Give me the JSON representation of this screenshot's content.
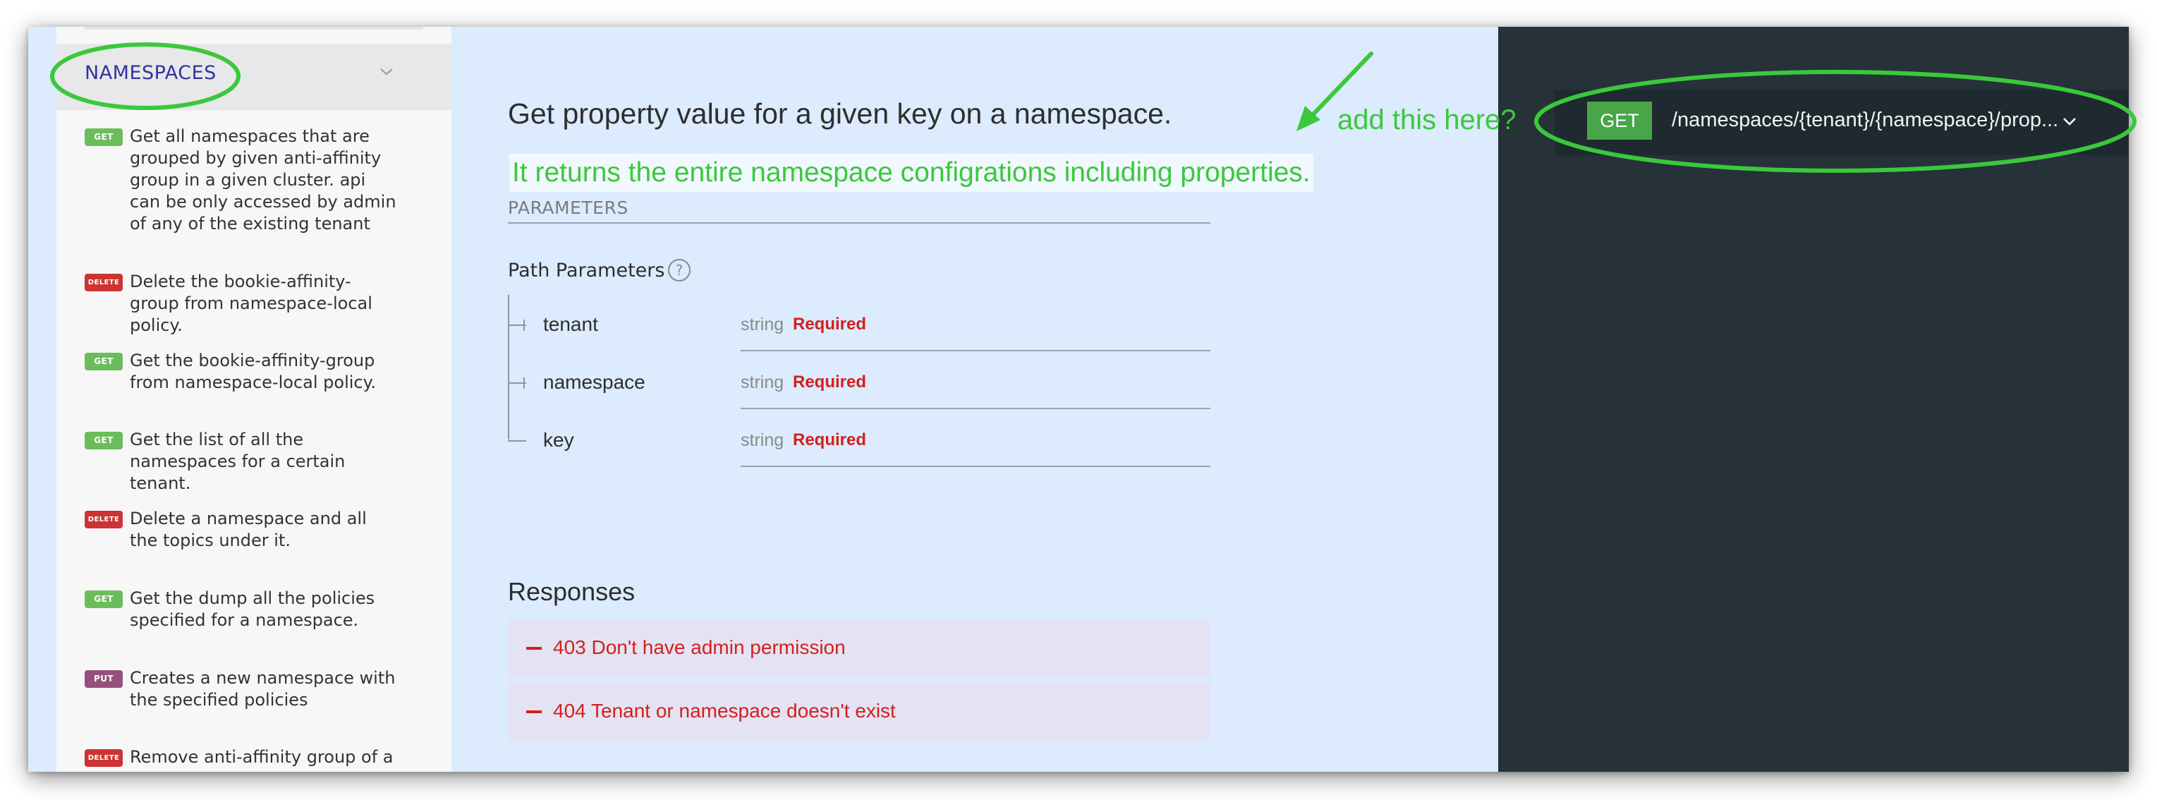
{
  "sidebar": {
    "section_label": "NAMESPACES",
    "items": [
      {
        "method": "GET",
        "text": "Get all namespaces that are grouped by given anti-affinity group in a given cluster. api can be only accessed by admin of any of the existing tenant"
      },
      {
        "method": "DELETE",
        "text": "Delete the bookie-affinity-group from namespace-local policy."
      },
      {
        "method": "GET",
        "text": "Get the bookie-affinity-group from namespace-local policy."
      },
      {
        "method": "GET",
        "text": "Get the list of all the namespaces for a certain tenant."
      },
      {
        "method": "DELETE",
        "text": "Delete a namespace and all the topics under it."
      },
      {
        "method": "GET",
        "text": "Get the dump all the policies specified for a namespace."
      },
      {
        "method": "PUT",
        "text": "Creates a new namespace with the specified policies"
      },
      {
        "method": "DELETE",
        "text": "Remove anti-affinity group of a"
      }
    ]
  },
  "operation": {
    "title": "Get property value for a given key on a namespace.",
    "description": "It returns the entire namespace configrations including properties.",
    "parameters_label": "PARAMETERS",
    "path_params_label": "Path Parameters",
    "help_icon": "?",
    "params": [
      {
        "name": "tenant",
        "type": "string",
        "required": "Required"
      },
      {
        "name": "namespace",
        "type": "string",
        "required": "Required"
      },
      {
        "name": "key",
        "type": "string",
        "required": "Required"
      }
    ],
    "responses_title": "Responses",
    "responses": [
      {
        "text": "403 Don't have admin permission"
      },
      {
        "text": "404 Tenant or namespace doesn't exist"
      }
    ]
  },
  "endpoint": {
    "method": "GET",
    "path": "/namespaces/{tenant}/{namespace}/prop..."
  },
  "annotation": {
    "text": "add this here?"
  },
  "colors": {
    "get": "#6bbd5b",
    "delete": "#cc3333",
    "put": "#95507c",
    "annotation": "#3bc83b",
    "required": "#d41f1c"
  }
}
